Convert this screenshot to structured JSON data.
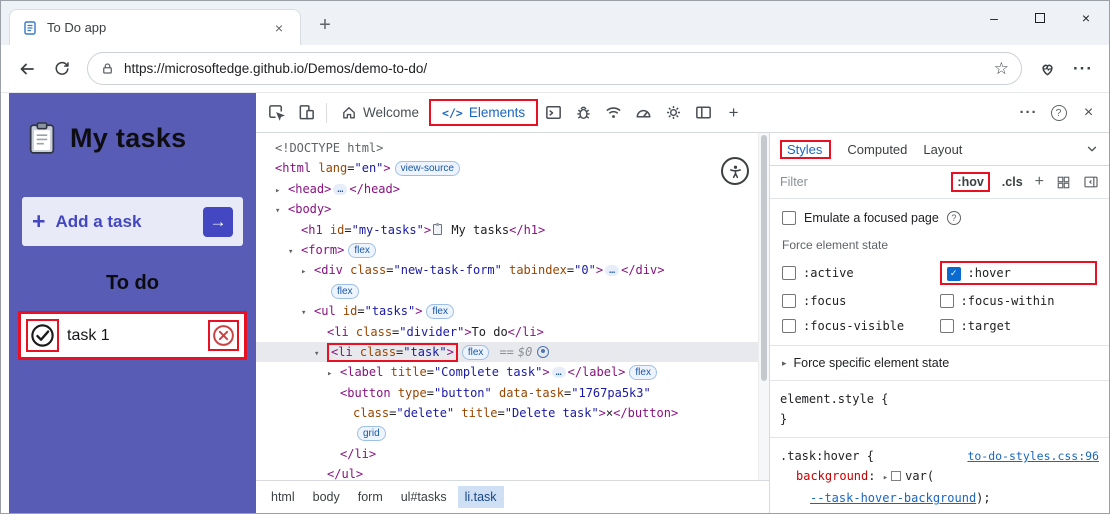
{
  "icons": {
    "check": "✓",
    "tri_down": "▾",
    "tri_right": "▸",
    "plus": "+",
    "minus": "–",
    "close": "×",
    "more": "···",
    "star": "☆",
    "help": "?"
  },
  "window": {
    "tab_title": "To Do app",
    "url": "https://microsoftedge.github.io/Demos/demo-to-do/"
  },
  "page": {
    "title": "My tasks",
    "add_button": {
      "plus": "+",
      "label": "Add a task",
      "arrow": "→"
    },
    "list_heading": "To do",
    "tasks": [
      {
        "label": "task 1"
      }
    ]
  },
  "devtools": {
    "toolbar": {
      "welcome_label": "Welcome",
      "elements_glyph": "</>",
      "elements_label": "Elements"
    },
    "dom_tree": {
      "lines": [
        {
          "indent": 0,
          "tokens": [
            {
              "c": "doctype",
              "s": "<!DOCTYPE html>"
            }
          ]
        },
        {
          "indent": 0,
          "tokens": [
            {
              "c": "tag",
              "s": "<html"
            },
            {
              "c": "sp",
              "s": " "
            },
            {
              "c": "attr",
              "s": "lang"
            },
            {
              "c": "punct",
              "s": "="
            },
            {
              "c": "val",
              "s": "\"en\""
            },
            {
              "c": "tag",
              "s": ">"
            },
            {
              "c": "badge",
              "s": "view-source"
            }
          ]
        },
        {
          "indent": 1,
          "arrow": "right",
          "tokens": [
            {
              "c": "tag",
              "s": "<head>"
            },
            {
              "c": "dots",
              "s": "…"
            },
            {
              "c": "tag",
              "s": "</head>"
            }
          ]
        },
        {
          "indent": 1,
          "arrow": "down",
          "tokens": [
            {
              "c": "tag",
              "s": "<body>"
            }
          ]
        },
        {
          "indent": 2,
          "tokens": [
            {
              "c": "tag",
              "s": "<h1"
            },
            {
              "c": "sp",
              "s": " "
            },
            {
              "c": "attr",
              "s": "id"
            },
            {
              "c": "punct",
              "s": "="
            },
            {
              "c": "val",
              "s": "\"my-tasks\""
            },
            {
              "c": "tag",
              "s": ">"
            },
            {
              "c": "emoji",
              "s": "clipboard"
            },
            {
              "c": "text",
              "s": " My tasks"
            },
            {
              "c": "tag",
              "s": "</h1>"
            }
          ]
        },
        {
          "indent": 2,
          "arrow": "down",
          "tokens": [
            {
              "c": "tag",
              "s": "<form>"
            },
            {
              "c": "badge",
              "s": "flex"
            }
          ]
        },
        {
          "indent": 3,
          "arrow": "right",
          "tokens": [
            {
              "c": "tag",
              "s": "<div"
            },
            {
              "c": "sp",
              "s": " "
            },
            {
              "c": "attr",
              "s": "class"
            },
            {
              "c": "punct",
              "s": "="
            },
            {
              "c": "val",
              "s": "\"new-task-form\""
            },
            {
              "c": "sp",
              "s": " "
            },
            {
              "c": "attr",
              "s": "tabindex"
            },
            {
              "c": "punct",
              "s": "="
            },
            {
              "c": "val",
              "s": "\"0\""
            },
            {
              "c": "tag",
              "s": ">"
            },
            {
              "c": "dots",
              "s": "…"
            },
            {
              "c": "tag",
              "s": "</div>"
            }
          ]
        },
        {
          "indent": 4,
          "tokens": [
            {
              "c": "badge",
              "s": "flex"
            }
          ]
        },
        {
          "indent": 3,
          "arrow": "down",
          "tokens": [
            {
              "c": "tag",
              "s": "<ul"
            },
            {
              "c": "sp",
              "s": " "
            },
            {
              "c": "attr",
              "s": "id"
            },
            {
              "c": "punct",
              "s": "="
            },
            {
              "c": "val",
              "s": "\"tasks\""
            },
            {
              "c": "tag",
              "s": ">"
            },
            {
              "c": "badge",
              "s": "flex"
            }
          ]
        },
        {
          "indent": 4,
          "tokens": [
            {
              "c": "tag",
              "s": "<li"
            },
            {
              "c": "sp",
              "s": " "
            },
            {
              "c": "attr",
              "s": "class"
            },
            {
              "c": "punct",
              "s": "="
            },
            {
              "c": "val",
              "s": "\"divider\""
            },
            {
              "c": "tag",
              "s": ">"
            },
            {
              "c": "text",
              "s": "To do"
            },
            {
              "c": "tag",
              "s": "</li>"
            }
          ]
        },
        {
          "indent": 4,
          "arrow": "down",
          "selected": true,
          "tokens": [
            {
              "c": "tag",
              "s": "<li",
              "box": true
            },
            {
              "c": "sp",
              "s": " ",
              "box": true
            },
            {
              "c": "attr",
              "s": "class",
              "box": true
            },
            {
              "c": "punct",
              "s": "=",
              "box": true
            },
            {
              "c": "val",
              "s": "\"task\"",
              "box": true
            },
            {
              "c": "tag",
              "s": ">",
              "box": true
            },
            {
              "c": "badge",
              "s": "flex"
            },
            {
              "c": "eq",
              "s": "=="
            },
            {
              "c": "dollar",
              "s": "$0"
            },
            {
              "c": "adorner",
              "s": ""
            }
          ]
        },
        {
          "indent": 5,
          "arrow": "right",
          "tokens": [
            {
              "c": "tag",
              "s": "<label"
            },
            {
              "c": "sp",
              "s": " "
            },
            {
              "c": "attr",
              "s": "title"
            },
            {
              "c": "punct",
              "s": "="
            },
            {
              "c": "val",
              "s": "\"Complete task\""
            },
            {
              "c": "tag",
              "s": ">"
            },
            {
              "c": "dots",
              "s": "…"
            },
            {
              "c": "tag",
              "s": "</label>"
            },
            {
              "c": "badge",
              "s": "flex"
            }
          ]
        },
        {
          "indent": 5,
          "tokens": [
            {
              "c": "tag",
              "s": "<button"
            },
            {
              "c": "sp",
              "s": " "
            },
            {
              "c": "attr",
              "s": "type"
            },
            {
              "c": "punct",
              "s": "="
            },
            {
              "c": "val",
              "s": "\"button\""
            },
            {
              "c": "sp",
              "s": " "
            },
            {
              "c": "attr",
              "s": "data-task"
            },
            {
              "c": "punct",
              "s": "="
            },
            {
              "c": "val",
              "s": "\"1767pa5k3\""
            }
          ]
        },
        {
          "indent": 6,
          "tokens": [
            {
              "c": "attr",
              "s": "class"
            },
            {
              "c": "punct",
              "s": "="
            },
            {
              "c": "val",
              "s": "\"delete\""
            },
            {
              "c": "sp",
              "s": " "
            },
            {
              "c": "attr",
              "s": "title"
            },
            {
              "c": "punct",
              "s": "="
            },
            {
              "c": "val",
              "s": "\"Delete task\""
            },
            {
              "c": "tag",
              "s": ">"
            },
            {
              "c": "text",
              "s": "×"
            },
            {
              "c": "tag",
              "s": "</button>"
            }
          ]
        },
        {
          "indent": 6,
          "tokens": [
            {
              "c": "badge",
              "s": "grid"
            }
          ]
        },
        {
          "indent": 5,
          "tokens": [
            {
              "c": "tag",
              "s": "</li>"
            }
          ]
        },
        {
          "indent": 4,
          "tokens": [
            {
              "c": "tag",
              "s": "</ul>"
            }
          ]
        }
      ]
    },
    "breadcrumbs": {
      "items": [
        "html",
        "body",
        "form",
        "ul#tasks",
        "li.task"
      ],
      "active": "li.task"
    },
    "styles": {
      "tabs": [
        "Styles",
        "Computed",
        "Layout"
      ],
      "filter_label": "Filter",
      "pseudo_toggle": ":hov",
      "class_toggle": ".cls",
      "emulate_label": "Emulate a focused page",
      "force_state_heading": "Force element state",
      "states": [
        {
          "label": ":active",
          "checked": false,
          "boxed": false
        },
        {
          "label": ":hover",
          "checked": true,
          "boxed": true
        },
        {
          "label": ":focus",
          "checked": false,
          "boxed": false
        },
        {
          "label": ":focus-within",
          "checked": false,
          "boxed": false
        },
        {
          "label": ":focus-visible",
          "checked": false,
          "boxed": false
        },
        {
          "label": ":target",
          "checked": false,
          "boxed": false
        }
      ],
      "force_specific_label": "Force specific element state",
      "element_style_open": "element.style {",
      "element_style_close": "}",
      "rule": {
        "selector": ".task:hover {",
        "source_link": "to-do-styles.css:96",
        "property": "background",
        "colon": ":",
        "value_open": "var(",
        "variable": "--task-hover-background",
        "value_close": ");"
      }
    }
  }
}
